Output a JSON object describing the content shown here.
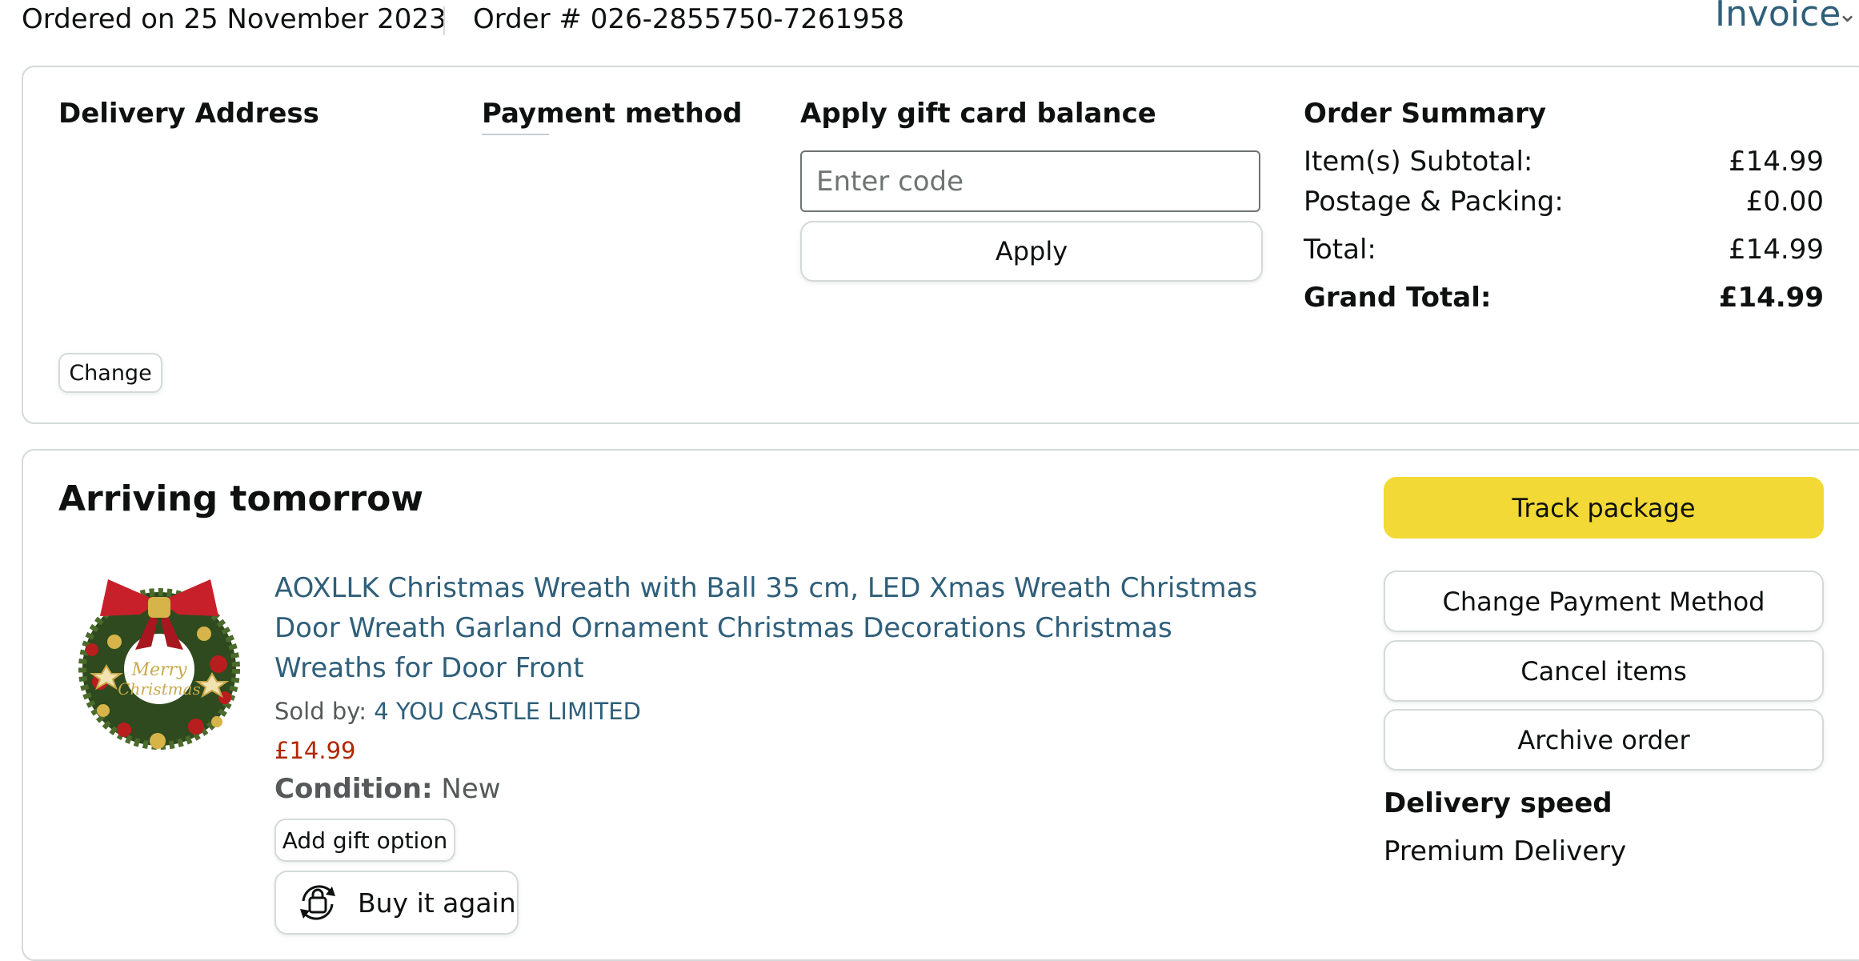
{
  "order_header": {
    "ordered_on": "Ordered on 25 November 2023",
    "order_number": "Order # 026-2855750-7261958",
    "invoice_label": "Invoice"
  },
  "details_card": {
    "delivery_address_heading": "Delivery Address",
    "change_label": "Change",
    "payment_method_heading": "Payment method",
    "gift_card": {
      "heading": "Apply gift card balance",
      "placeholder": "Enter code",
      "value": "",
      "apply_label": "Apply"
    },
    "order_summary": {
      "heading": "Order Summary",
      "rows": [
        {
          "label": "Item(s) Subtotal:",
          "value": "£14.99"
        },
        {
          "label": "Postage & Packing:",
          "value": "£0.00"
        },
        {
          "label": "Total:",
          "value": "£14.99"
        },
        {
          "label": "Grand Total:",
          "value": "£14.99"
        }
      ]
    }
  },
  "shipment": {
    "status_heading": "Arriving tomorrow",
    "item": {
      "title": "AOXLLK Christmas Wreath with Ball 35 cm, LED Xmas Wreath Christmas Door Wreath Garland Ornament Christmas Decorations Christmas Wreaths for Door Front",
      "sold_by_label": "Sold by: ",
      "seller": "4 YOU CASTLE LIMITED",
      "price": "£14.99",
      "condition_label": "Condition:",
      "condition_value": "New",
      "add_gift_label": "Add gift option",
      "buy_again_label": "Buy it again",
      "image_text": "Merry Christmas"
    },
    "actions": {
      "track": "Track package",
      "change_payment": "Change Payment Method",
      "cancel": "Cancel items",
      "archive": "Archive order"
    },
    "delivery_speed_heading": "Delivery speed",
    "delivery_speed_value": "Premium Delivery"
  },
  "colors": {
    "link": "#2f5f7a",
    "price": "#b12704",
    "track_button": "#f2d935",
    "border": "#d5d9d9"
  }
}
